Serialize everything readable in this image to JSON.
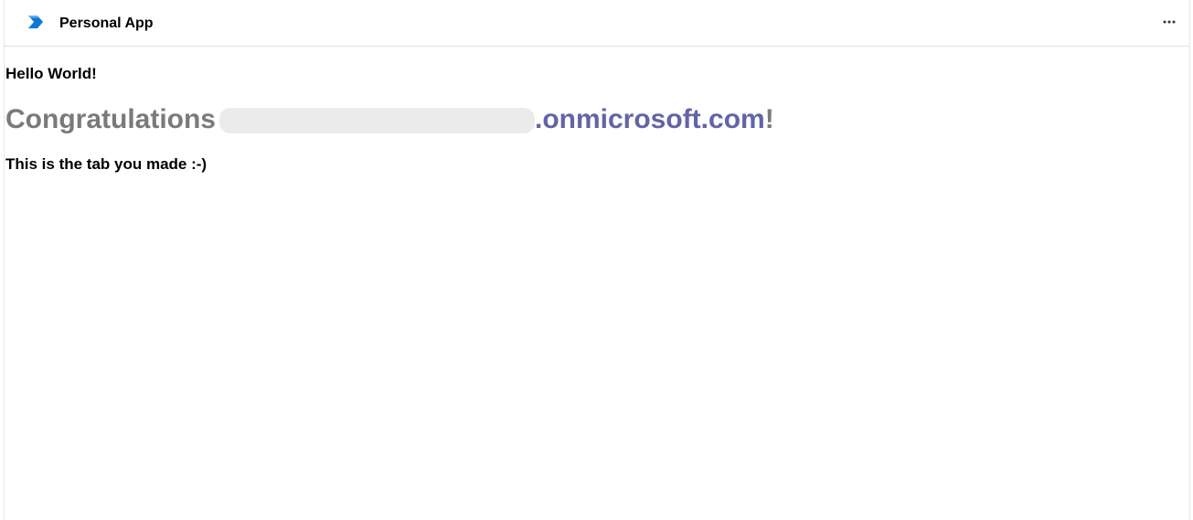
{
  "header": {
    "app_title": "Personal App",
    "app_icon": "personal-app-icon",
    "more_icon": "more-options-icon",
    "more_label": "···"
  },
  "main": {
    "hello": "Hello World!",
    "congrats_word": "Congratulations",
    "email_domain": ".onmicrosoft.com",
    "congrats_suffix": "!",
    "tab_note": "This is the tab you made :-)"
  },
  "colors": {
    "accent": "#6264a7",
    "icon_blue": "#0f78d4",
    "congrats_gray": "#7a7a7a"
  }
}
